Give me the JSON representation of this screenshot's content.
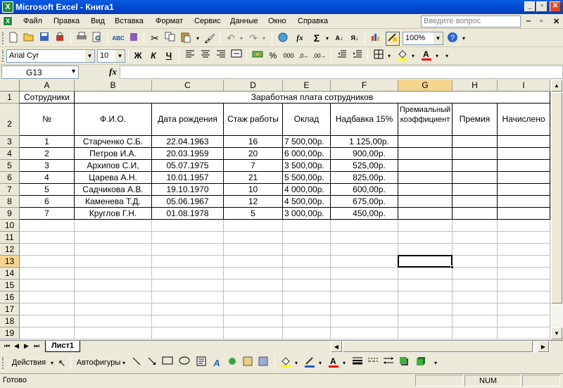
{
  "window": {
    "title": "Microsoft Excel - Книга1",
    "minimize": "_",
    "restore": "▫",
    "close": "✕"
  },
  "menu": {
    "items": [
      "Файл",
      "Правка",
      "Вид",
      "Вставка",
      "Формат",
      "Сервис",
      "Данные",
      "Окно",
      "Справка"
    ],
    "help_placeholder": "Введите вопрос",
    "doc_controls": [
      "‒",
      "▫",
      "✕"
    ]
  },
  "toolbar1": {
    "zoom": "100%",
    "icons": [
      "new-icon",
      "open-icon",
      "save-icon",
      "permission-icon",
      "print-icon",
      "print-preview-icon",
      "spelling-icon",
      "research-icon",
      "cut-icon",
      "copy-icon",
      "paste-icon",
      "format-painter-icon",
      "undo-icon",
      "redo-icon",
      "hyperlink-icon",
      "insert-function-icon",
      "autosum-icon",
      "sort-ascending-icon",
      "sort-descending-icon",
      "chart-wizard-icon",
      "drawing-icon",
      "help-icon"
    ],
    "fx_label": "fx",
    "sigma_label": "Σ"
  },
  "toolbar2": {
    "font": "Arial Cyr",
    "size": "10",
    "bold": "Ж",
    "italic": "К",
    "underline": "Ч",
    "percent": "%",
    "thousands": "000"
  },
  "formula_bar": {
    "name_box": "G13",
    "fx": "fx",
    "content": ""
  },
  "sheet": {
    "columns": [
      "A",
      "B",
      "C",
      "D",
      "E",
      "F",
      "G",
      "H",
      "I"
    ],
    "rows": [
      "1",
      "2",
      "3",
      "4",
      "5",
      "6",
      "7",
      "8",
      "9",
      "10",
      "11",
      "12",
      "13",
      "14",
      "15",
      "16",
      "17",
      "18",
      "19"
    ],
    "a1": "Сотрудники",
    "merged_title": "Заработная плата сотрудников",
    "headers": [
      "№",
      "Ф.И.О.",
      "Дата рождения",
      "Стаж работы",
      "Оклад",
      "Надбавка 15%",
      "Премиальный коэффициент",
      "Премия",
      "Начислено"
    ],
    "data": [
      [
        "1",
        "Старченко С.Б.",
        "22.04.1963",
        "16",
        "7 500,00р.",
        "1 125,00р."
      ],
      [
        "2",
        "Петров И.А.",
        "20.03.1959",
        "20",
        "6 000,00р.",
        "900,00р."
      ],
      [
        "3",
        "Архипов С.И,",
        "05.07.1975",
        "7",
        "3 500,00р.",
        "525,00р."
      ],
      [
        "4",
        "Царева А.Н.",
        "10.01.1957",
        "21",
        "5 500,00р.",
        "825,00р."
      ],
      [
        "5",
        "Садчикова А.В.",
        "19.10.1970",
        "10",
        "4 000,00р.",
        "600,00р."
      ],
      [
        "6",
        "Каменева Т.Д.",
        "05.06.1967",
        "12",
        "4 500,00р.",
        "675,00р."
      ],
      [
        "7",
        "Круглов Г.Н.",
        "01.08.1978",
        "5",
        "3 000,00р.",
        "450,00р."
      ]
    ],
    "selected_cell": "G13"
  },
  "tabs": {
    "active": "Лист1",
    "nav": [
      "⏮",
      "◀",
      "▶",
      "⏭"
    ]
  },
  "drawing": {
    "actions": "Действия",
    "autoshapes": "Автофигуры"
  },
  "status": {
    "text": "Готово",
    "num": "NUM"
  },
  "colors": {
    "title_bar": "#0046cf",
    "selected_header": "#f5d48f",
    "face": "#ece9d8"
  }
}
